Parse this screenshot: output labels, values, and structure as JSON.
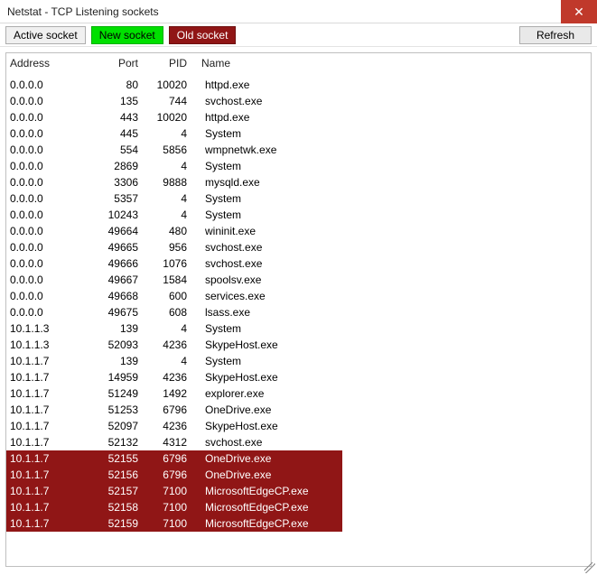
{
  "window": {
    "title": "Netstat - TCP Listening sockets",
    "close_glyph": "✕"
  },
  "legend": {
    "active": "Active socket",
    "new": "New socket",
    "old": "Old socket"
  },
  "actions": {
    "refresh": "Refresh"
  },
  "columns": {
    "address": "Address",
    "port": "Port",
    "pid": "PID",
    "name": "Name"
  },
  "colors": {
    "new_bg": "#00e000",
    "old_bg": "#901616",
    "close_bg": "#c0392b"
  },
  "rows": [
    {
      "address": "0.0.0.0",
      "port": "80",
      "pid": "10020",
      "name": "httpd.exe",
      "state": "active"
    },
    {
      "address": "0.0.0.0",
      "port": "135",
      "pid": "744",
      "name": "svchost.exe",
      "state": "active"
    },
    {
      "address": "0.0.0.0",
      "port": "443",
      "pid": "10020",
      "name": "httpd.exe",
      "state": "active"
    },
    {
      "address": "0.0.0.0",
      "port": "445",
      "pid": "4",
      "name": "System",
      "state": "active"
    },
    {
      "address": "0.0.0.0",
      "port": "554",
      "pid": "5856",
      "name": "wmpnetwk.exe",
      "state": "active"
    },
    {
      "address": "0.0.0.0",
      "port": "2869",
      "pid": "4",
      "name": "System",
      "state": "active"
    },
    {
      "address": "0.0.0.0",
      "port": "3306",
      "pid": "9888",
      "name": "mysqld.exe",
      "state": "active"
    },
    {
      "address": "0.0.0.0",
      "port": "5357",
      "pid": "4",
      "name": "System",
      "state": "active"
    },
    {
      "address": "0.0.0.0",
      "port": "10243",
      "pid": "4",
      "name": "System",
      "state": "active"
    },
    {
      "address": "0.0.0.0",
      "port": "49664",
      "pid": "480",
      "name": "wininit.exe",
      "state": "active"
    },
    {
      "address": "0.0.0.0",
      "port": "49665",
      "pid": "956",
      "name": "svchost.exe",
      "state": "active"
    },
    {
      "address": "0.0.0.0",
      "port": "49666",
      "pid": "1076",
      "name": "svchost.exe",
      "state": "active"
    },
    {
      "address": "0.0.0.0",
      "port": "49667",
      "pid": "1584",
      "name": "spoolsv.exe",
      "state": "active"
    },
    {
      "address": "0.0.0.0",
      "port": "49668",
      "pid": "600",
      "name": "services.exe",
      "state": "active"
    },
    {
      "address": "0.0.0.0",
      "port": "49675",
      "pid": "608",
      "name": "lsass.exe",
      "state": "active"
    },
    {
      "address": "10.1.1.3",
      "port": "139",
      "pid": "4",
      "name": "System",
      "state": "active"
    },
    {
      "address": "10.1.1.3",
      "port": "52093",
      "pid": "4236",
      "name": "SkypeHost.exe",
      "state": "active"
    },
    {
      "address": "10.1.1.7",
      "port": "139",
      "pid": "4",
      "name": "System",
      "state": "active"
    },
    {
      "address": "10.1.1.7",
      "port": "14959",
      "pid": "4236",
      "name": "SkypeHost.exe",
      "state": "active"
    },
    {
      "address": "10.1.1.7",
      "port": "51249",
      "pid": "1492",
      "name": "explorer.exe",
      "state": "active"
    },
    {
      "address": "10.1.1.7",
      "port": "51253",
      "pid": "6796",
      "name": "OneDrive.exe",
      "state": "active"
    },
    {
      "address": "10.1.1.7",
      "port": "52097",
      "pid": "4236",
      "name": "SkypeHost.exe",
      "state": "active"
    },
    {
      "address": "10.1.1.7",
      "port": "52132",
      "pid": "4312",
      "name": "svchost.exe",
      "state": "active"
    },
    {
      "address": "10.1.1.7",
      "port": "52155",
      "pid": "6796",
      "name": "OneDrive.exe",
      "state": "old"
    },
    {
      "address": "10.1.1.7",
      "port": "52156",
      "pid": "6796",
      "name": "OneDrive.exe",
      "state": "old"
    },
    {
      "address": "10.1.1.7",
      "port": "52157",
      "pid": "7100",
      "name": "MicrosoftEdgeCP.exe",
      "state": "old"
    },
    {
      "address": "10.1.1.7",
      "port": "52158",
      "pid": "7100",
      "name": "MicrosoftEdgeCP.exe",
      "state": "old"
    },
    {
      "address": "10.1.1.7",
      "port": "52159",
      "pid": "7100",
      "name": "MicrosoftEdgeCP.exe",
      "state": "old"
    }
  ]
}
